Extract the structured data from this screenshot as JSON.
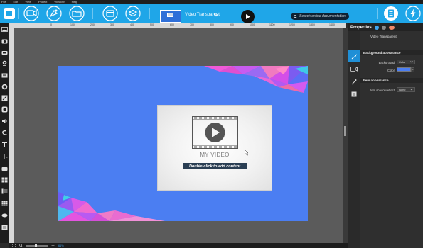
{
  "menu": {
    "items": [
      "File",
      "Edit",
      "View",
      "Project",
      "Window",
      "Help"
    ]
  },
  "toolbar": {
    "scene_name": "Video Transparent",
    "search_placeholder": "Search online documentation"
  },
  "ruler": {
    "ticks": [
      "0",
      "100",
      "200",
      "300",
      "400",
      "500",
      "600",
      "700",
      "800",
      "900",
      "1000",
      "1100",
      "1200",
      "1300",
      "1400"
    ]
  },
  "canvas": {
    "slide_color": "#4b7ef2",
    "video_title": "MY VIDEO",
    "video_hint": "Double-click to add content"
  },
  "status": {
    "zoom": "61%"
  },
  "properties": {
    "title": "Properties",
    "object_name": "Video Transparent",
    "background_section": "Background appearance",
    "background_label": "Background",
    "background_value": "Color",
    "color_label": "Color",
    "color_value": "#4b7ef2",
    "item_section": "Item appearance",
    "shadow_label": "Item shadow effect",
    "shadow_value": "None"
  },
  "colors": {
    "toolbar": "#1fa6e8",
    "accent": "#1f8fd6"
  },
  "icons": {
    "toolbar": [
      "new-icon",
      "screen-recording-icon",
      "paint-icon",
      "folder-icon",
      "window-icon",
      "layers-icon",
      "play-icon",
      "search-icon",
      "document-icon",
      "lightning-icon"
    ],
    "tools": [
      "image-icon",
      "shape-icon",
      "button-icon",
      "location-icon",
      "text-block-icon",
      "timer-icon",
      "pencil-icon",
      "record-icon",
      "audio-icon",
      "arrow-icon",
      "text-icon",
      "text-field-icon",
      "rectangle-icon",
      "table-icon",
      "list-icon",
      "grid-icon",
      "ellipse-icon",
      "slider-icon"
    ]
  }
}
